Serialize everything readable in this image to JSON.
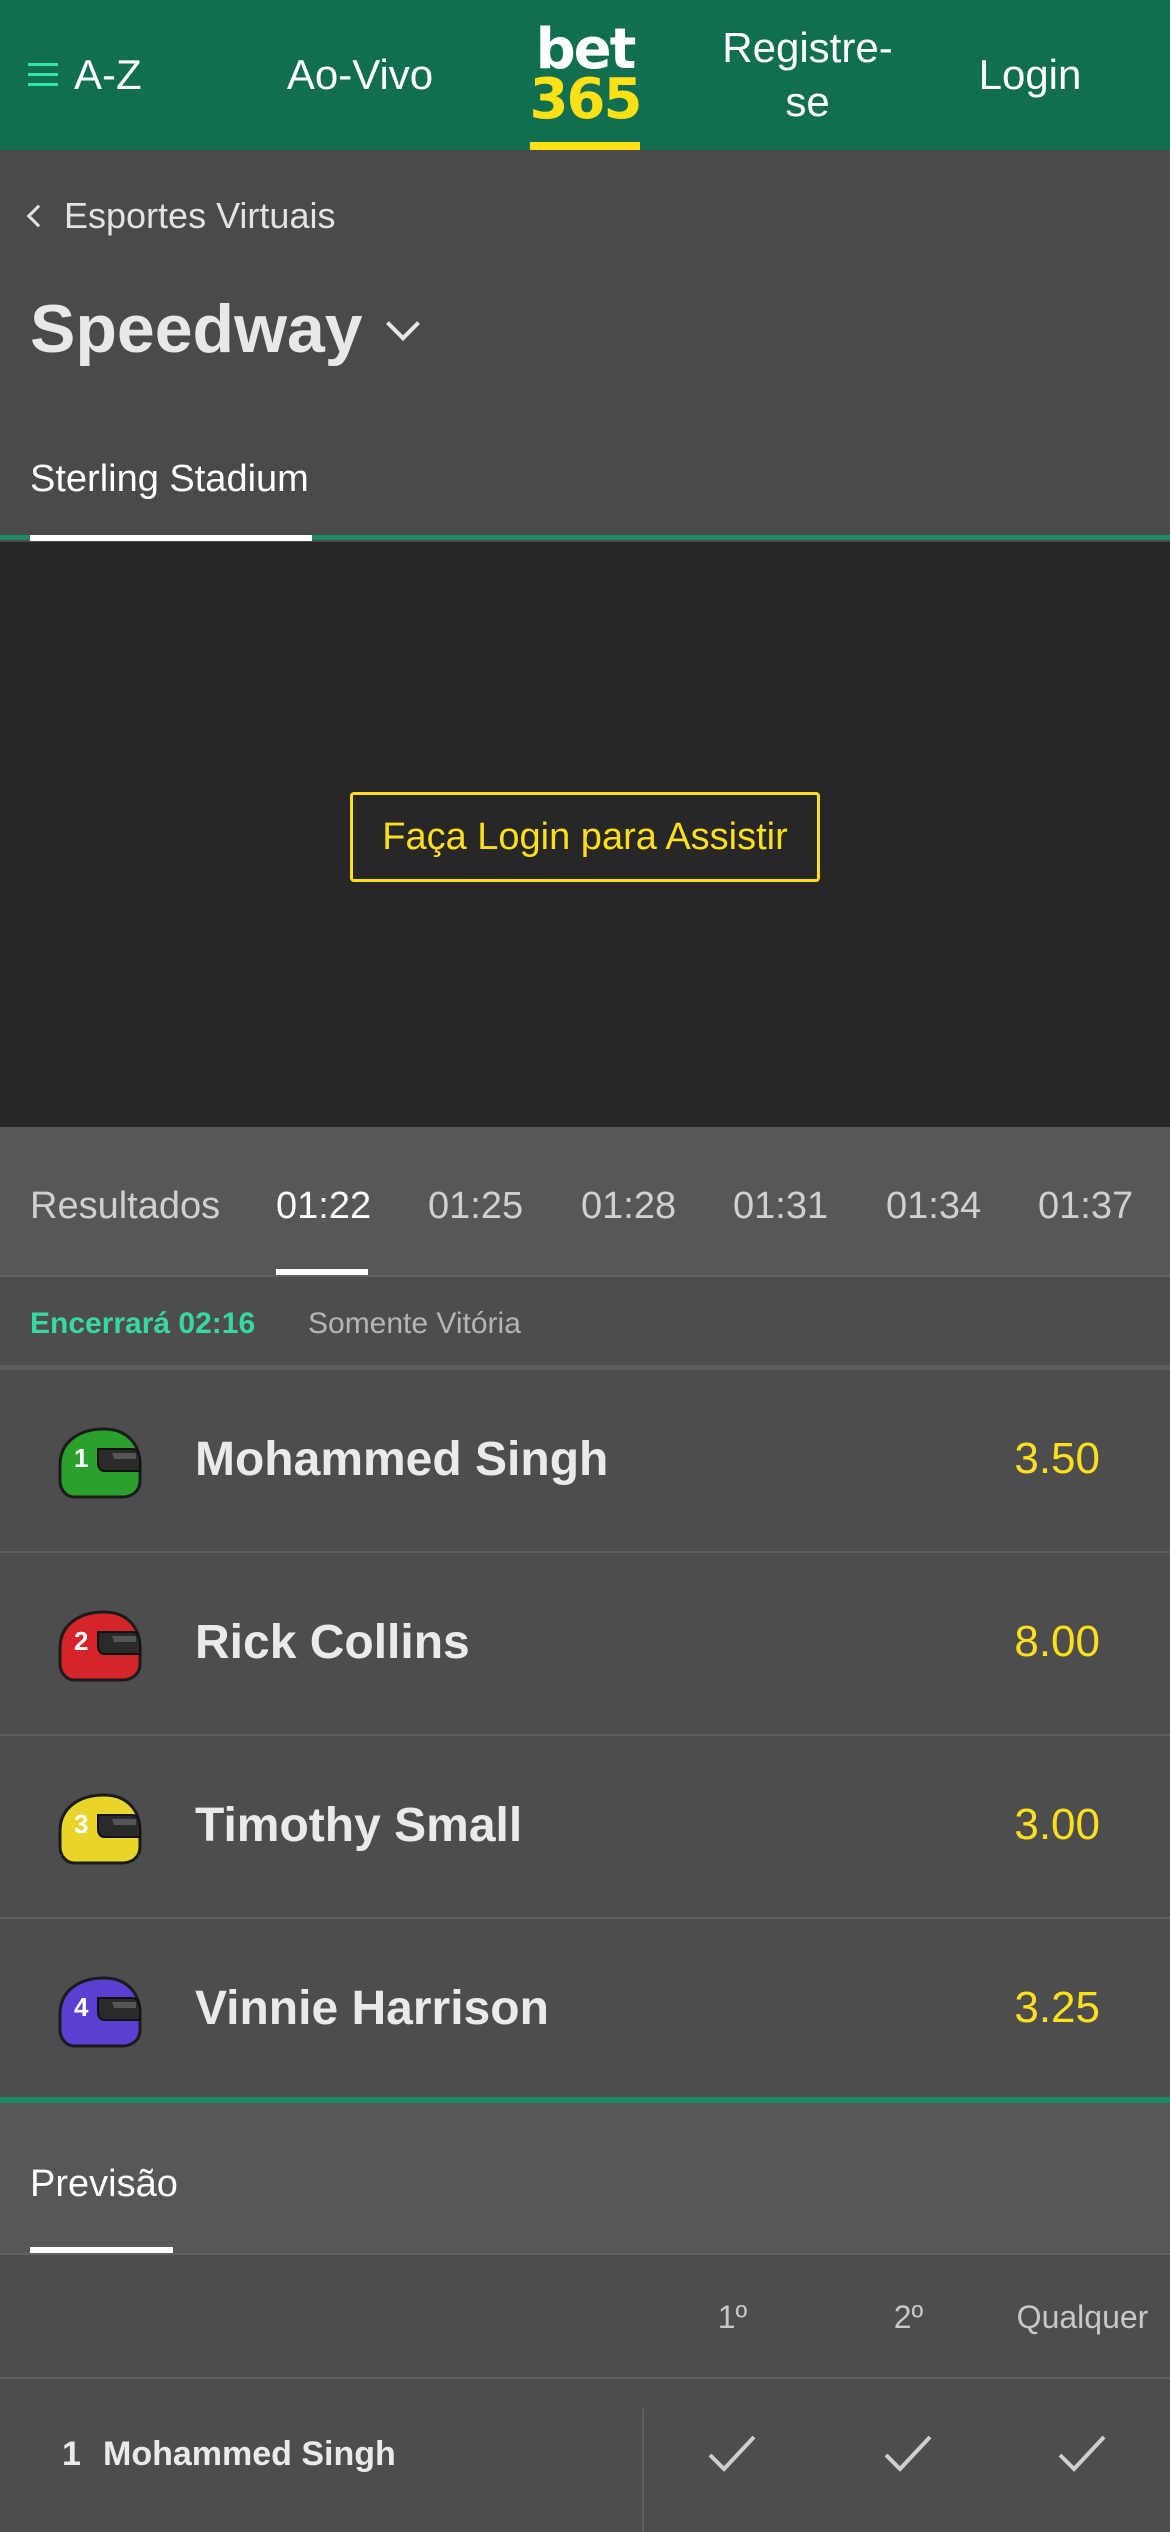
{
  "header": {
    "menu_label": "A-Z",
    "live_label": "Ao-Vivo",
    "logo_top": "bet",
    "logo_bottom": "365",
    "register_line1": "Registre-",
    "register_line2": "se",
    "login_label": "Login"
  },
  "breadcrumb": {
    "back_label": "Esportes Virtuais"
  },
  "page": {
    "title": "Speedway",
    "venue_tab": "Sterling Stadium"
  },
  "video": {
    "watch_button": "Faça Login para Assistir"
  },
  "race_tabs": {
    "results_label": "Resultados",
    "times": [
      "01:22",
      "01:25",
      "01:28",
      "01:31",
      "01:34",
      "01:37"
    ],
    "active_time": "01:22"
  },
  "race_status": {
    "closes": "Encerrará 02:16",
    "market": "Somente Vitória"
  },
  "runners": [
    {
      "number": "1",
      "name": "Mohammed Singh",
      "odds": "3.50",
      "helmet_color": "#2aa12c",
      "helmet_icon": "green-helmet-icon"
    },
    {
      "number": "2",
      "name": "Rick Collins",
      "odds": "8.00",
      "helmet_color": "#d4252a",
      "helmet_icon": "red-helmet-icon"
    },
    {
      "number": "3",
      "name": "Timothy Small",
      "odds": "3.00",
      "helmet_color": "#e9d42a",
      "helmet_icon": "yellow-helmet-icon"
    },
    {
      "number": "4",
      "name": "Vinnie Harrison",
      "odds": "3.25",
      "helmet_color": "#5a3fd1",
      "helmet_icon": "purple-helmet-icon"
    }
  ],
  "forecast": {
    "tab_label": "Previsão",
    "columns": [
      "1º",
      "2º",
      "Qualquer"
    ],
    "rows": [
      {
        "number": "1",
        "name": "Mohammed Singh"
      }
    ]
  },
  "colors": {
    "brand_green": "#126e51",
    "accent_yellow": "#ffdf1b",
    "accent_mint": "#38d9a0"
  }
}
